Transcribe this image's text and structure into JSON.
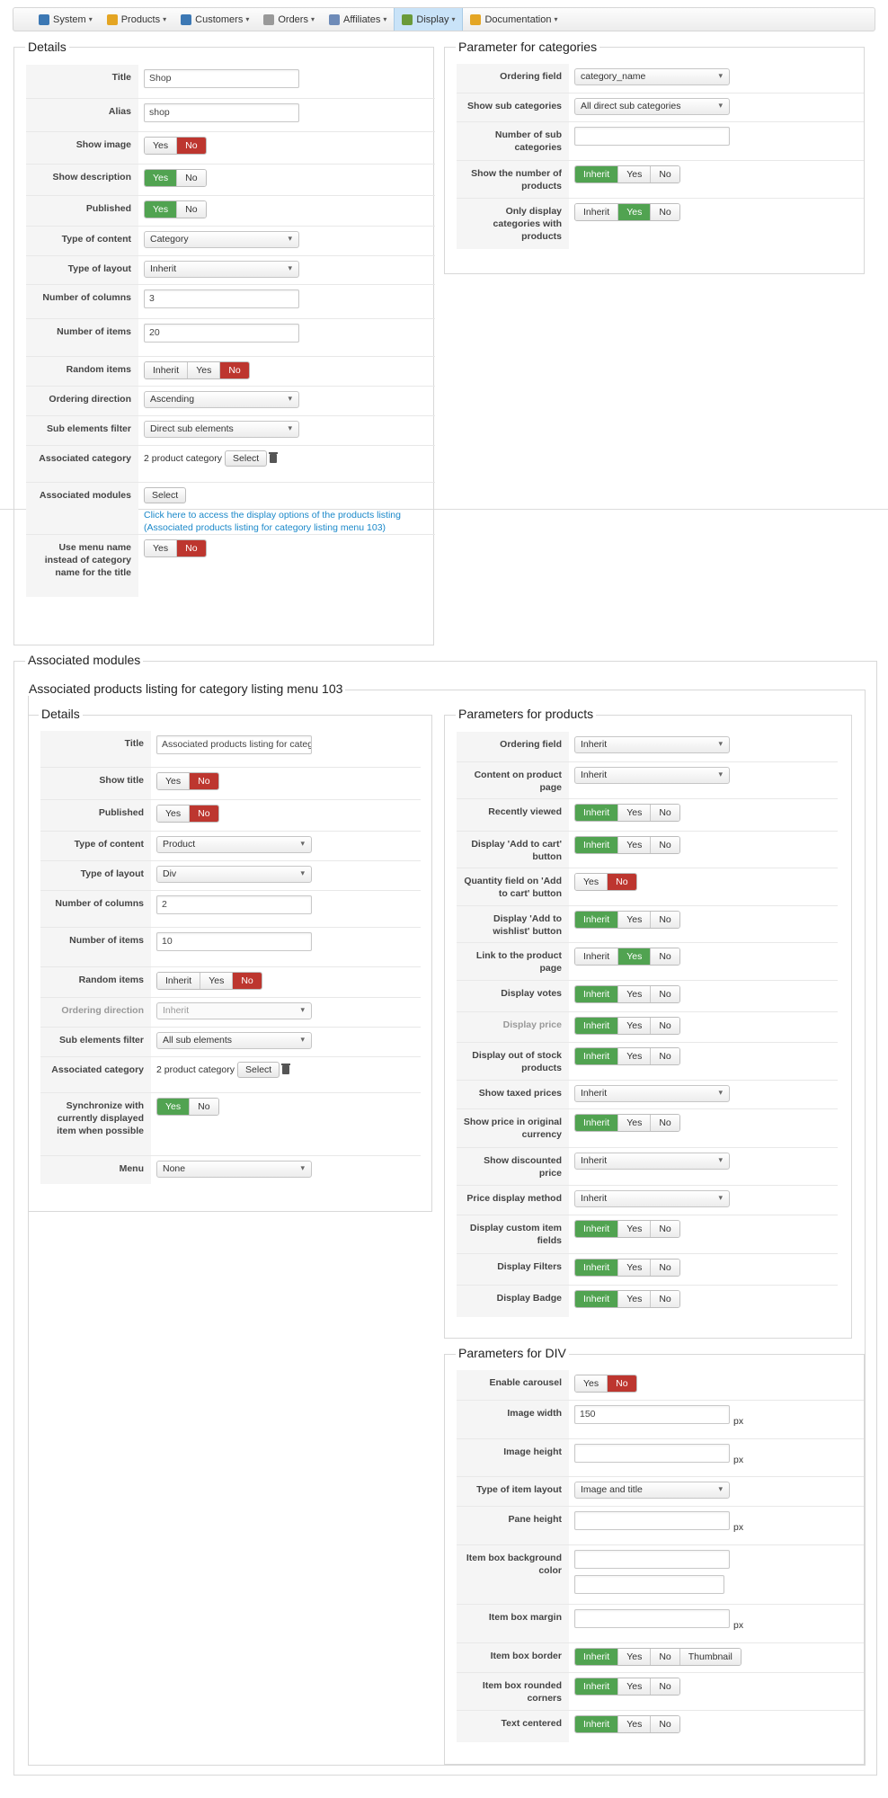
{
  "menu": [
    {
      "label": "System",
      "icon": "tools-icon",
      "color": "#3c78b4"
    },
    {
      "label": "Products",
      "icon": "products-icon",
      "color": "#e4a523"
    },
    {
      "label": "Customers",
      "icon": "customers-icon",
      "color": "#3c78b4"
    },
    {
      "label": "Orders",
      "icon": "orders-icon",
      "color": "#999999"
    },
    {
      "label": "Affiliates",
      "icon": "affiliates-icon",
      "color": "#6e8bb8"
    },
    {
      "label": "Display",
      "icon": "display-icon",
      "color": "#6a9a3a",
      "active": true
    },
    {
      "label": "Documentation",
      "icon": "documentation-icon",
      "color": "#e4a523"
    }
  ],
  "cat_details": {
    "legend": "Details",
    "title_label": "Title",
    "title_value": "Shop",
    "alias_label": "Alias",
    "alias_value": "shop",
    "show_image": "Show image",
    "show_description": "Show description",
    "published": "Published",
    "type_content": "Type of content",
    "type_content_value": "Category",
    "type_layout": "Type of layout",
    "type_layout_value": "Inherit",
    "num_columns": "Number of columns",
    "num_columns_value": "3",
    "num_items": "Number of items",
    "num_items_value": "20",
    "random_items": "Random items",
    "ordering_direction": "Ordering direction",
    "ordering_direction_value": "Ascending",
    "sub_filter": "Sub elements filter",
    "sub_filter_value": "Direct sub elements",
    "assoc_category": "Associated category",
    "assoc_category_value": "2 product category",
    "assoc_modules": "Associated modules",
    "link": "Click here to access the display options of the products listing (Associated products listing for category listing menu 103)",
    "use_menu_name": "Use menu name instead of category name for the title"
  },
  "labels": {
    "yes": "Yes",
    "no": "No",
    "inherit": "Inherit",
    "select": "Select",
    "thumbnail": "Thumbnail",
    "px": "px"
  },
  "cat_params": {
    "legend": "Parameter for categories",
    "ordering_field": "Ordering field",
    "ordering_field_value": "category_name",
    "show_sub": "Show sub categories",
    "show_sub_value": "All direct sub categories",
    "num_sub": "Number of sub categories",
    "show_num": "Show the number of products",
    "only_display": "Only display categories with products"
  },
  "modules": {
    "legend": "Associated modules",
    "sub_title": "Associated products listing for category listing menu 103"
  },
  "mod_details": {
    "legend": "Details",
    "title": "Title",
    "title_value": "Associated products listing for categ",
    "show_title": "Show title",
    "published": "Published",
    "type_content": "Type of content",
    "type_content_value": "Product",
    "type_layout": "Type of layout",
    "type_layout_value": "Div",
    "num_columns": "Number of columns",
    "num_columns_value": "2",
    "num_items": "Number of items",
    "num_items_value": "10",
    "random_items": "Random items",
    "ordering_direction": "Ordering direction",
    "ordering_direction_value": "Inherit",
    "sub_filter": "Sub elements filter",
    "sub_filter_value": "All sub elements",
    "assoc_category": "Associated category",
    "assoc_category_value": "2 product category",
    "sync": "Synchronize with currently displayed item when possible",
    "menu": "Menu",
    "menu_value": "None"
  },
  "prod_params": {
    "legend": "Parameters for products",
    "ordering_field": "Ordering field",
    "ordering_field_value": "Inherit",
    "content_page": "Content on product page",
    "content_page_value": "Inherit",
    "recently": "Recently viewed",
    "add_cart": "Display 'Add to cart' button",
    "qty_field": "Quantity field on 'Add to cart' button",
    "wishlist": "Display 'Add to wishlist' button",
    "link_page": "Link to the product page",
    "votes": "Display votes",
    "price": "Display price",
    "out_stock": "Display out of stock products",
    "taxed": "Show taxed prices",
    "taxed_value": "Inherit",
    "orig_currency": "Show price in original currency",
    "discounted": "Show discounted price",
    "discounted_value": "Inherit",
    "price_method": "Price display method",
    "price_method_value": "Inherit",
    "custom_fields": "Display custom item fields",
    "filters": "Display Filters",
    "badge": "Display Badge"
  },
  "div_params": {
    "legend": "Parameters for DIV",
    "carousel": "Enable carousel",
    "img_width": "Image width",
    "img_width_value": "150",
    "img_height": "Image height",
    "item_layout": "Type of item layout",
    "item_layout_value": "Image and title",
    "pane_height": "Pane height",
    "bg_color": "Item box background color",
    "margin": "Item box margin",
    "border": "Item box border",
    "rounded": "Item box rounded corners",
    "centered": "Text centered"
  }
}
